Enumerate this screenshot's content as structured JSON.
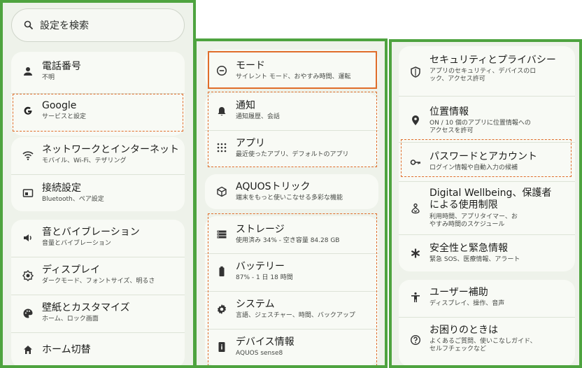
{
  "search": {
    "placeholder": "設定を検索",
    "icon": "search-icon"
  },
  "panel1": {
    "items": [
      {
        "title": "電話番号",
        "subtitle": "不明",
        "icon": "person-icon"
      },
      {
        "title": "Google",
        "subtitle": "サービスと設定",
        "icon": "google-icon"
      },
      {
        "title": "ネットワークとインターネット",
        "subtitle": "モバイル、Wi-Fi、テザリング",
        "icon": "wifi-icon"
      },
      {
        "title": "接続設定",
        "subtitle": "Bluetooth、ペア設定",
        "icon": "connected-devices-icon"
      },
      {
        "title": "音とバイブレーション",
        "subtitle": "音量とバイブレーション",
        "icon": "volume-icon"
      },
      {
        "title": "ディスプレイ",
        "subtitle": "ダークモード、フォントサイズ、明るさ",
        "icon": "brightness-icon"
      },
      {
        "title": "壁紙とカスタマイズ",
        "subtitle": "ホーム、ロック画面",
        "icon": "palette-icon"
      },
      {
        "title": "ホーム切替",
        "subtitle": "",
        "icon": "home-icon"
      }
    ]
  },
  "panel2": {
    "items": [
      {
        "title": "モード",
        "subtitle": "サイレント モード、おやすみ時間、運転",
        "icon": "mode-icon"
      },
      {
        "title": "通知",
        "subtitle": "通知履歴、会話",
        "icon": "bell-icon"
      },
      {
        "title": "アプリ",
        "subtitle": "最近使ったアプリ、デフォルトのアプリ",
        "icon": "apps-grid-icon"
      },
      {
        "title": "AQUOSトリック",
        "subtitle": "端末をもっと使いこなせる多彩な機能",
        "icon": "cube-icon"
      },
      {
        "title": "ストレージ",
        "subtitle": "使用済み 34% - 空き容量 84.28 GB",
        "icon": "storage-icon"
      },
      {
        "title": "バッテリー",
        "subtitle": "87% - 1 日 18 時間",
        "icon": "battery-icon"
      },
      {
        "title": "システム",
        "subtitle": "言語、ジェスチャー、時間、バックアップ",
        "icon": "system-gear-icon"
      },
      {
        "title": "デバイス情報",
        "subtitle": "AQUOS sense8",
        "icon": "device-info-icon"
      }
    ]
  },
  "panel3": {
    "items": [
      {
        "title": "セキュリティとプライバシー",
        "subtitle": "アプリのセキュリティ、デバイスのロック、アクセス許可",
        "icon": "shield-icon"
      },
      {
        "title": "位置情報",
        "subtitle": "ON / 10 個のアプリに位置情報へのアクセスを許可",
        "icon": "location-icon"
      },
      {
        "title": "パスワードとアカウント",
        "subtitle": "ログイン情報や自動入力の候補",
        "icon": "key-icon"
      },
      {
        "title": "Digital Wellbeing、保護者による使用制限",
        "subtitle": "利用時間、アプリタイマー、おやすみ時間のスケジュール",
        "icon": "wellbeing-icon"
      },
      {
        "title": "安全性と緊急情報",
        "subtitle": "緊急 SOS、医療情報、アラート",
        "icon": "emergency-icon"
      },
      {
        "title": "ユーザー補助",
        "subtitle": "ディスプレイ、操作、音声",
        "icon": "accessibility-icon"
      },
      {
        "title": "お困りのときは",
        "subtitle": "よくあるご質問、使いこなしガイド、セルフチェックなど",
        "icon": "help-icon"
      }
    ]
  },
  "colors": {
    "panel_border": "#4ea33f",
    "highlight": "#e06d2a",
    "card_bg": "#f8faf5",
    "panel_bg": "#eef2ea"
  }
}
